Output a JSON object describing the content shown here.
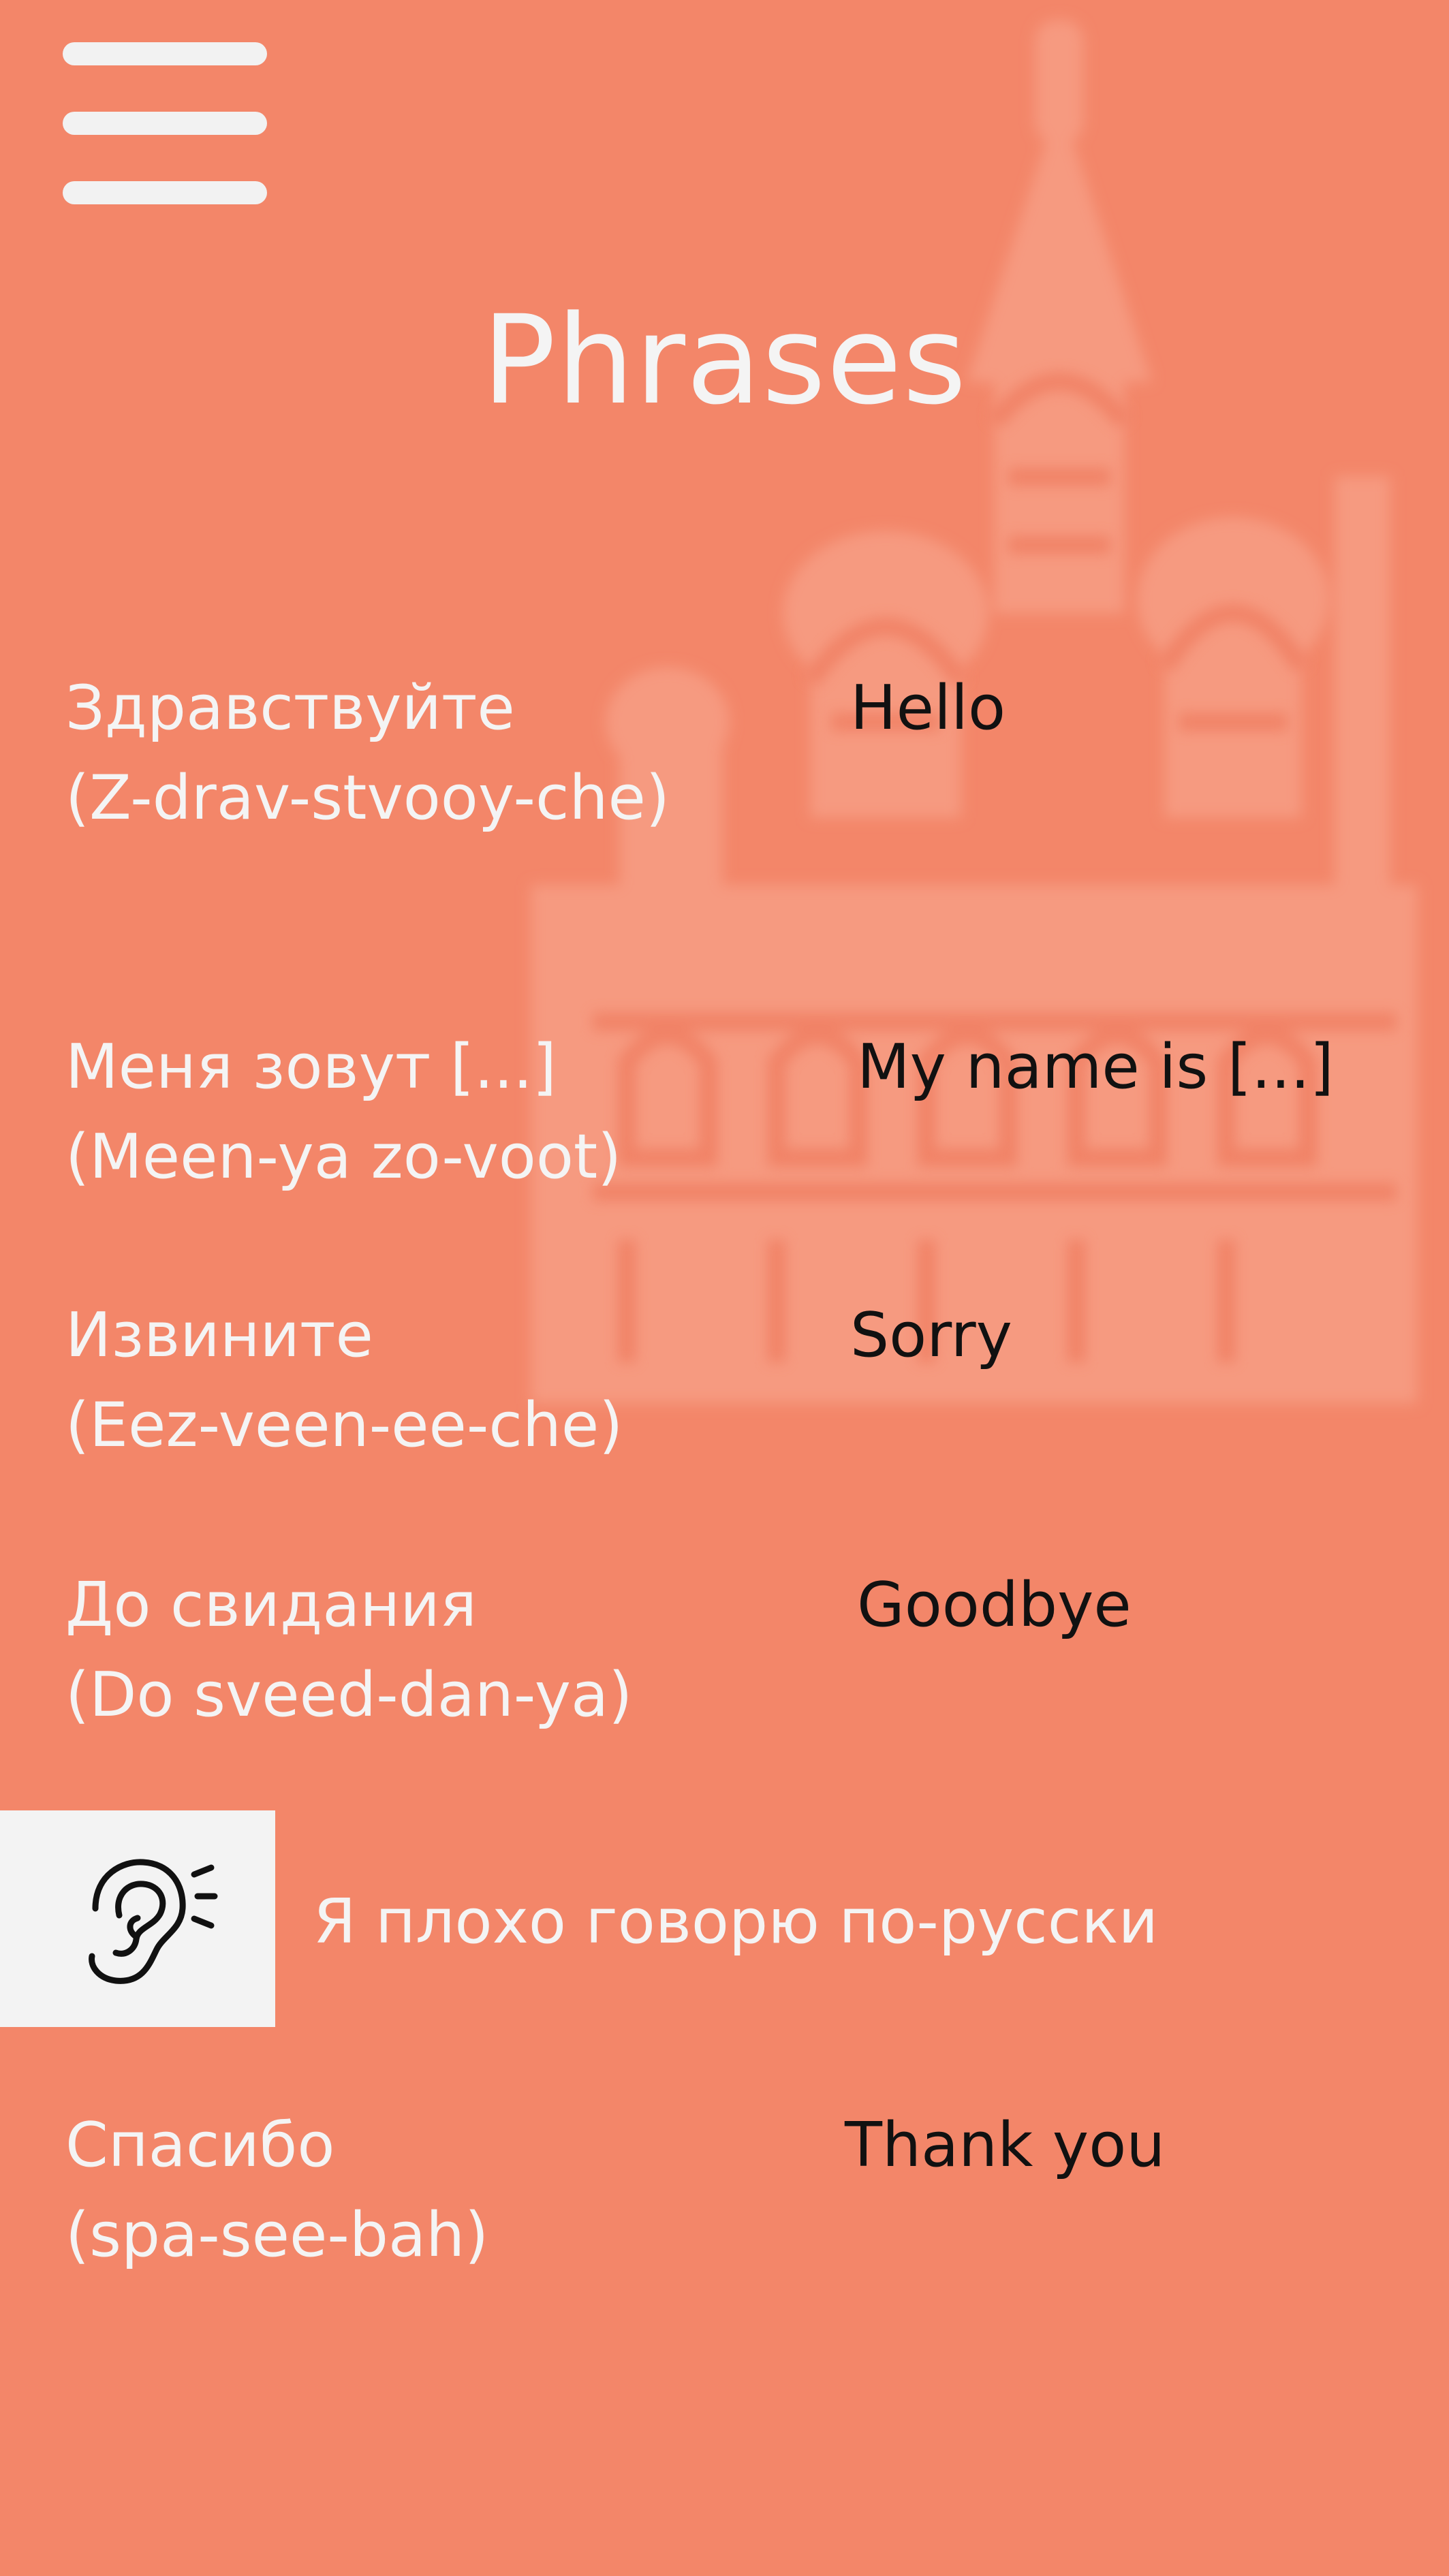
{
  "app": {
    "title": "Phrases",
    "menu_icon": "hamburger-menu-icon",
    "background_color": "#f38669",
    "text_light": "#f4f4f4",
    "text_dark": "#111111"
  },
  "phrases": [
    {
      "russian": "Здравствуйте",
      "pronunciation": "(Z-drav-stvooy-che)",
      "english": "Hello"
    },
    {
      "russian": "Меня зовут [...]",
      "pronunciation": "(Meen-ya zo-voot)",
      "english": "My name is [...]"
    },
    {
      "russian": "Извините",
      "pronunciation": "(Eez-veen-ee-che)",
      "english": "Sorry"
    },
    {
      "russian": "До свидания",
      "pronunciation": "(Do sveed-dan-ya)",
      "english": "Goodbye"
    },
    {
      "russian": "Спасибо",
      "pronunciation": "(spa-see-bah)",
      "english": "Thank you"
    }
  ],
  "listen": {
    "icon": "ear-listen-icon",
    "text": "Я плохо говорю по-русски",
    "panel_color": "#f3f3f3"
  }
}
